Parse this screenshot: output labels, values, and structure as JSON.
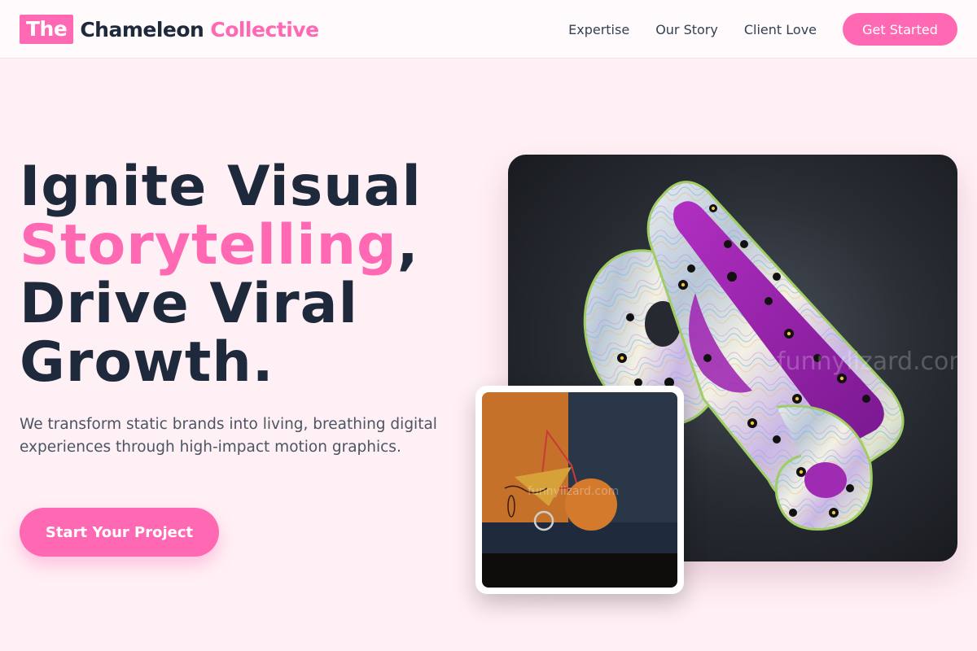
{
  "brand": {
    "badge": "The",
    "name": "Chameleon",
    "accent": "Collective",
    "accent_color": "#ff69b4"
  },
  "nav": {
    "links": [
      "Expertise",
      "Our Story",
      "Client Love"
    ],
    "cta": "Get Started"
  },
  "hero": {
    "headline_line1": "Ignite Visual",
    "headline_highlight": "Storytelling",
    "headline_comma": ",",
    "headline_line3": "Drive Viral",
    "headline_line4": "Growth.",
    "subtext": "We transform static brands into living, breathing digital experiences through high-impact motion graphics.",
    "cta": "Start Your Project"
  },
  "images": {
    "main_watermark": "funnylizard.com",
    "thumb_watermark": "funnylizard.com"
  },
  "colors": {
    "background": "#fff0f5",
    "primary": "#ff69b4",
    "text_dark": "#1e293b"
  }
}
